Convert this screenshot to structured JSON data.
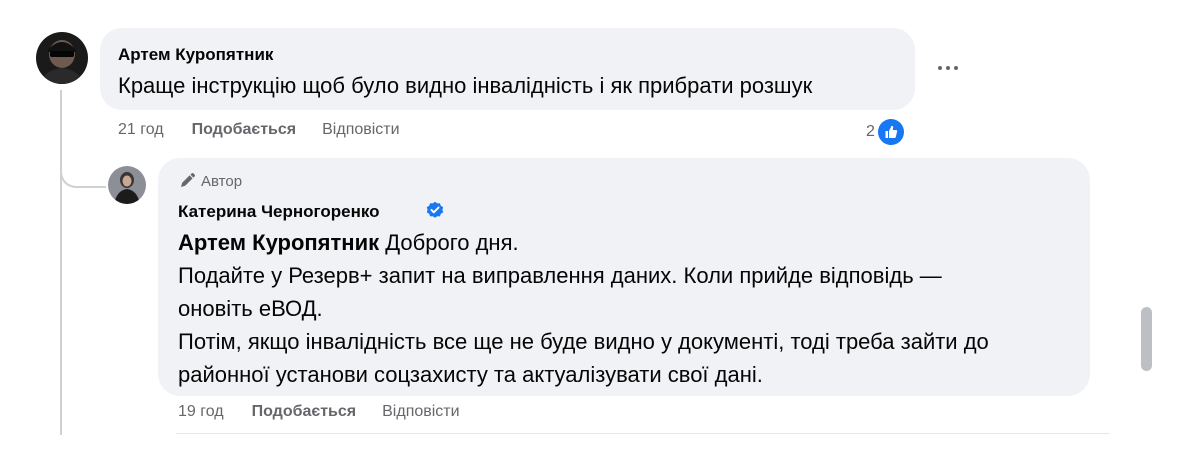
{
  "comments": [
    {
      "author": "Артем Куропятник",
      "text": "Краще інструкцію щоб було видно інвалідність і як прибрати розшук",
      "time": "21 год",
      "like_label": "Подобається",
      "reply_label": "Відповісти",
      "reaction_count": "2",
      "reaction_icon": "like-icon",
      "more_icon": "more-options-icon"
    },
    {
      "role_label": "Автор",
      "role_icon": "pen-icon",
      "author": "Катерина Черногоренко",
      "verified_icon": "verified-badge-icon",
      "mention": "Артем Куропятник",
      "greeting": " Доброго дня.",
      "line2": "Подайте у Резерв+ запит на виправлення даних. Коли прийде відповідь —",
      "line3": "оновіть еВОД.",
      "line4": "Потім, якщо інвалідність все ще не буде видно у документі, тоді треба зайти до",
      "line5": "районної установи соцзахисту та актуалізувати свої дані.",
      "time": "19 год",
      "like_label": "Подобається",
      "reply_label": "Відповісти"
    }
  ],
  "colors": {
    "bubble": "#f0f2f5",
    "secondary_text": "#65676b",
    "like_blue": "#1877f2",
    "thread_line": "#ced0d4"
  }
}
